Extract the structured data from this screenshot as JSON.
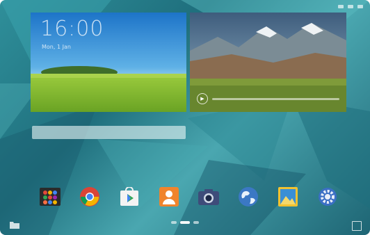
{
  "status_bar": {
    "icons": [
      "signal-icon",
      "wifi-icon",
      "battery-icon"
    ]
  },
  "clock_widget": {
    "time": "16:00",
    "date": "Mon, 1 Jan"
  },
  "photo_widget": {
    "icons": [
      "play-icon"
    ]
  },
  "search_bar": {
    "placeholder": ""
  },
  "dock": {
    "apps": [
      {
        "name": "apps-icon",
        "label": ""
      },
      {
        "name": "chrome-icon",
        "label": ""
      },
      {
        "name": "play-store-icon",
        "label": ""
      },
      {
        "name": "contacts-icon",
        "label": ""
      },
      {
        "name": "camera-icon",
        "label": ""
      },
      {
        "name": "internet-icon",
        "label": ""
      },
      {
        "name": "gallery-icon",
        "label": ""
      },
      {
        "name": "settings-icon",
        "label": ""
      }
    ]
  },
  "page_indicator": {
    "pages": 3,
    "current": 1
  },
  "colors": {
    "wallpaper": "#2f8f9a",
    "accent": "#3b78c4"
  }
}
